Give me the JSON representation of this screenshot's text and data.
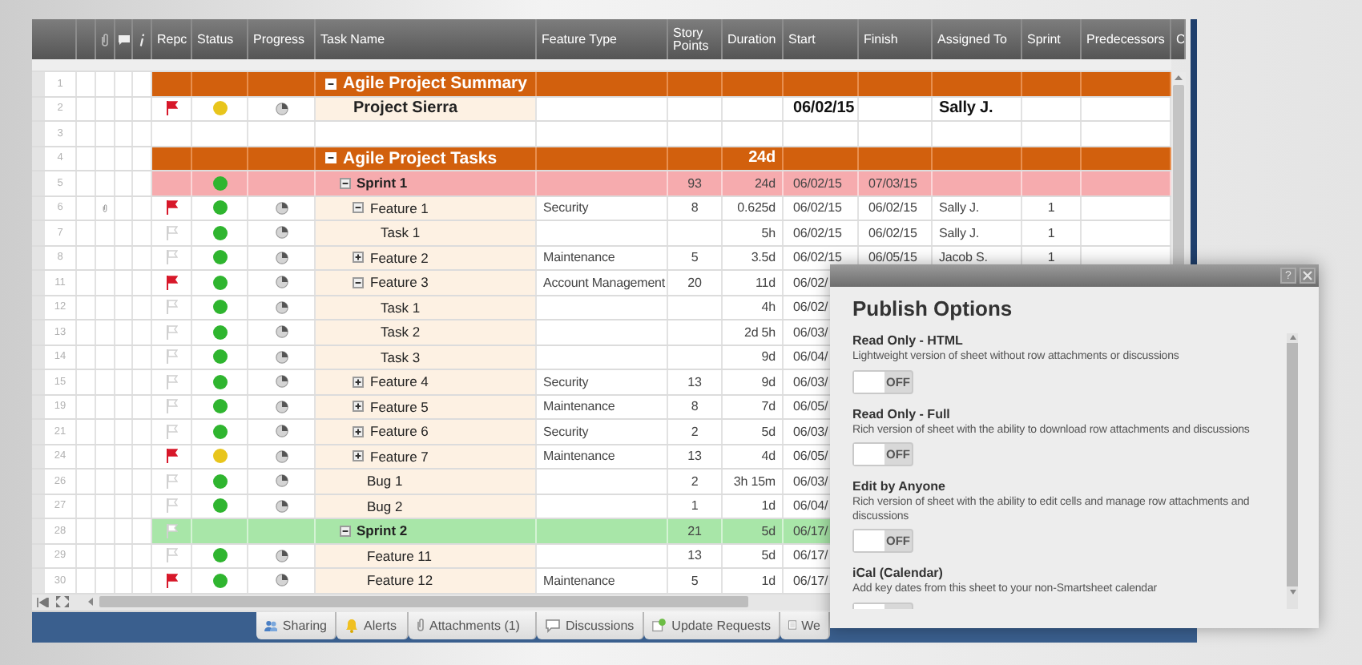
{
  "sheet": {
    "columns": [
      "Repc",
      "Status",
      "Progress",
      "Task Name",
      "Feature Type",
      "Story Points",
      "Duration",
      "Start",
      "Finish",
      "Assigned To",
      "Sprint",
      "Predecessors",
      "C"
    ],
    "rows": [
      {
        "number": "1",
        "kind": "section",
        "task": "Agile Project Summary",
        "expanded": true,
        "children": [
          {
            "number": "2",
            "kind": "project",
            "flagged": true,
            "status": {
              "color": "#e8c51c"
            },
            "task": "Project Sierra",
            "start": "06/02/15",
            "assigned": "Sally J."
          }
        ]
      },
      {
        "number": "3",
        "kind": "blank"
      },
      {
        "number": "4",
        "kind": "section",
        "task": "Agile Project Tasks",
        "expanded": true,
        "duration": "24d",
        "children": [
          {
            "number": "5",
            "kind": "sprint",
            "color": "#f6abae",
            "status": {
              "color": "#2fb52f"
            },
            "task": "Sprint 1",
            "expanded": true,
            "points": "93",
            "duration": "24d",
            "start": "06/02/15",
            "finish": "07/03/15",
            "children": [
              {
                "number": "6",
                "kind": "item",
                "attachment": true,
                "flagged": true,
                "status": {
                  "color": "#2fb52f"
                },
                "task": "Feature 1",
                "expanded": true,
                "feature_type": "Security",
                "points": "8",
                "duration": "0.625d",
                "start": "06/02/15",
                "finish": "06/02/15",
                "assigned": "Sally J.",
                "sprint": "1",
                "children": [
                  {
                    "number": "7",
                    "kind": "item",
                    "flagged": false,
                    "status": {
                      "color": "#2fb52f"
                    },
                    "task": "Task 1",
                    "duration": "5h",
                    "start": "06/02/15",
                    "finish": "06/02/15",
                    "assigned": "Sally J.",
                    "sprint": "1"
                  }
                ]
              },
              {
                "number": "8",
                "kind": "item",
                "flagged": false,
                "status": {
                  "color": "#2fb52f"
                },
                "task": "Feature 2",
                "expanded": false,
                "feature_type": "Maintenance",
                "points": "5",
                "duration": "3.5d",
                "start": "06/02/15",
                "finish": "06/05/15",
                "assigned": "Jacob S.",
                "sprint": "1"
              },
              {
                "number": "11",
                "kind": "item",
                "flagged": true,
                "status": {
                  "color": "#2fb52f"
                },
                "task": "Feature 3",
                "expanded": true,
                "feature_type": "Account Management",
                "points": "20",
                "duration": "11d",
                "start": "06/02/",
                "children": [
                  {
                    "number": "12",
                    "kind": "item",
                    "flagged": false,
                    "status": {
                      "color": "#2fb52f"
                    },
                    "task": "Task 1",
                    "duration": "4h",
                    "start": "06/02/"
                  },
                  {
                    "number": "13",
                    "kind": "item",
                    "flagged": false,
                    "status": {
                      "color": "#2fb52f"
                    },
                    "task": "Task 2",
                    "duration": "2d 5h",
                    "start": "06/03/"
                  },
                  {
                    "number": "14",
                    "kind": "item",
                    "flagged": false,
                    "status": {
                      "color": "#2fb52f"
                    },
                    "task": "Task 3",
                    "duration": "9d",
                    "start": "06/04/"
                  }
                ]
              },
              {
                "number": "15",
                "kind": "item",
                "flagged": false,
                "status": {
                  "color": "#2fb52f"
                },
                "task": "Feature 4",
                "expanded": false,
                "feature_type": "Security",
                "points": "13",
                "duration": "9d",
                "start": "06/03/"
              },
              {
                "number": "19",
                "kind": "item",
                "flagged": false,
                "status": {
                  "color": "#2fb52f"
                },
                "task": "Feature 5",
                "expanded": false,
                "feature_type": "Maintenance",
                "points": "8",
                "duration": "7d",
                "start": "06/05/"
              },
              {
                "number": "21",
                "kind": "item",
                "flagged": false,
                "status": {
                  "color": "#2fb52f"
                },
                "task": "Feature 6",
                "expanded": false,
                "feature_type": "Security",
                "points": "2",
                "duration": "5d",
                "start": "06/03/"
              },
              {
                "number": "24",
                "kind": "item",
                "flagged": true,
                "status": {
                  "color": "#e8c51c"
                },
                "task": "Feature 7",
                "expanded": false,
                "feature_type": "Maintenance",
                "points": "13",
                "duration": "4d",
                "start": "06/05/"
              },
              {
                "number": "26",
                "kind": "item",
                "flagged": false,
                "status": {
                  "color": "#2fb52f"
                },
                "task": "Bug 1",
                "points": "2",
                "duration": "3h 15m",
                "start": "06/03/"
              },
              {
                "number": "27",
                "kind": "item",
                "flagged": false,
                "status": {
                  "color": "#2fb52f"
                },
                "task": "Bug 2",
                "points": "1",
                "duration": "1d",
                "start": "06/04/"
              }
            ]
          },
          {
            "number": "28",
            "kind": "sprint",
            "color": "#a8e6a8",
            "flagged": false,
            "task": "Sprint 2",
            "expanded": true,
            "points": "21",
            "duration": "5d",
            "start": "06/17/",
            "children": [
              {
                "number": "29",
                "kind": "item",
                "flagged": false,
                "status": {
                  "color": "#2fb52f"
                },
                "task": "Feature 11",
                "points": "13",
                "duration": "5d",
                "start": "06/17/"
              },
              {
                "number": "30",
                "kind": "item",
                "flagged": true,
                "status": {
                  "color": "#2fb52f"
                },
                "task": "Feature 12",
                "feature_type": "Maintenance",
                "points": "5",
                "duration": "1d",
                "start": "06/17/"
              }
            ]
          }
        ]
      }
    ]
  },
  "bottom_tabs": [
    {
      "kind": "sharing",
      "label": "Sharing"
    },
    {
      "kind": "alerts",
      "label": "Alerts"
    },
    {
      "kind": "attachments",
      "label": "Attachments (1)"
    },
    {
      "kind": "discussions",
      "label": "Discussions"
    },
    {
      "kind": "requests",
      "label": "Update Requests"
    },
    {
      "kind": "forms",
      "label": "We"
    }
  ],
  "dialog": {
    "help": "?",
    "title": "Publish Options",
    "options": [
      {
        "label": "Read Only - HTML",
        "description": "Lightweight version of sheet without row attachments or discussions",
        "on": false,
        "toggle_text": "OFF"
      },
      {
        "label": "Read Only - Full",
        "description": "Rich version of sheet with the ability to download row attachments and discussions",
        "on": false,
        "toggle_text": "OFF"
      },
      {
        "label": "Edit by Anyone",
        "description": "Rich version of sheet with the ability to edit cells and manage row attachments and discussions",
        "on": false,
        "toggle_text": "OFF"
      },
      {
        "label": "iCal (Calendar)",
        "description": "Add key dates from this sheet to your non-Smartsheet calendar",
        "on": false
      }
    ]
  }
}
